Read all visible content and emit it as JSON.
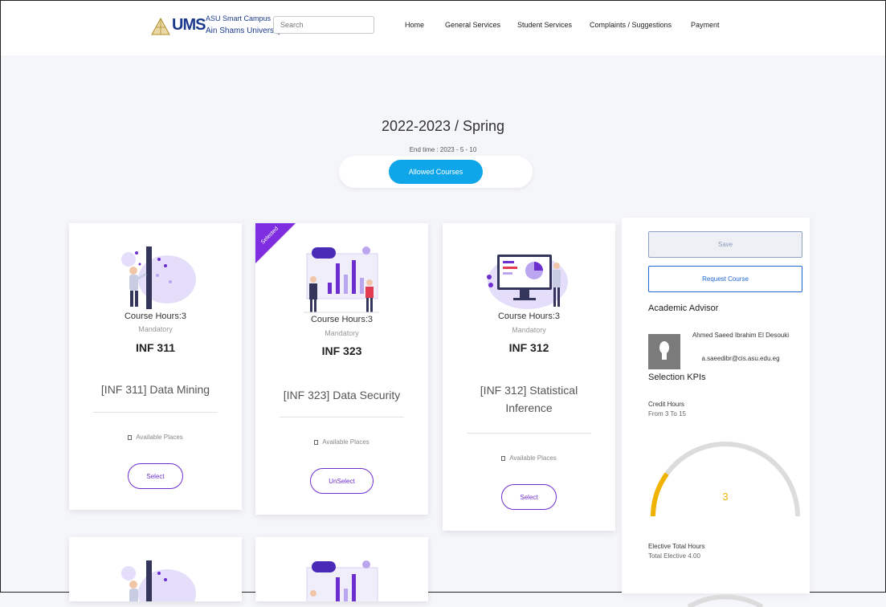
{
  "header": {
    "logo_mark": "UMS",
    "logo_line1": "ASU Smart Campus",
    "logo_line2": "Ain Shams University.",
    "search_placeholder": "Search",
    "nav": [
      "Home",
      "General Services",
      "Student Services",
      "Complaints / Suggestions",
      "Payment"
    ]
  },
  "term": {
    "title": "2022-2023 / Spring",
    "end_time": "End time : 2023 - 5 - 10",
    "tab_label": "Allowed Courses"
  },
  "courses": [
    {
      "hours": "Course Hours:3",
      "type": "Mandatory",
      "code": "INF 311",
      "name": "[INF 311] Data Mining",
      "places": "Available Places",
      "action": "Select",
      "selected": false,
      "illustration": "person-tree-illustration"
    },
    {
      "hours": "Course Hours:3",
      "type": "Mandatory",
      "code": "INF 323",
      "name": "[INF 323] Data Security",
      "places": "Available Places",
      "action": "UnSelect",
      "selected": true,
      "ribbon": "Selected",
      "illustration": "people-chart-illustration"
    },
    {
      "hours": "Course Hours:3",
      "type": "Mandatory",
      "code": "INF 312",
      "name": "[INF 312] Statistical Inference",
      "places": "Available Places",
      "action": "Select",
      "selected": false,
      "illustration": "monitor-chart-illustration"
    }
  ],
  "panel": {
    "save_label": "Save",
    "request_label": "Request Course",
    "advisor_heading": "Academic Advisor",
    "advisor_name": "Ahmed Saeed Ibrahim El Desouki",
    "advisor_email": "a.saeedibr@cis.asu.edu.eg",
    "kpi_heading": "Selection KPIs",
    "credit_label": "Credit Hours",
    "credit_range": "From 3 To 15",
    "credit_min": 3,
    "credit_max": 15,
    "credit_value": "3",
    "elective_label": "Elective Total Hours",
    "elective_total": "Total Elective 4.00"
  },
  "colors": {
    "primary": "#0ea5e9",
    "purple": "#6d2ecf",
    "gauge_fill": "#f0b400",
    "gauge_track": "#dcdcdc"
  }
}
